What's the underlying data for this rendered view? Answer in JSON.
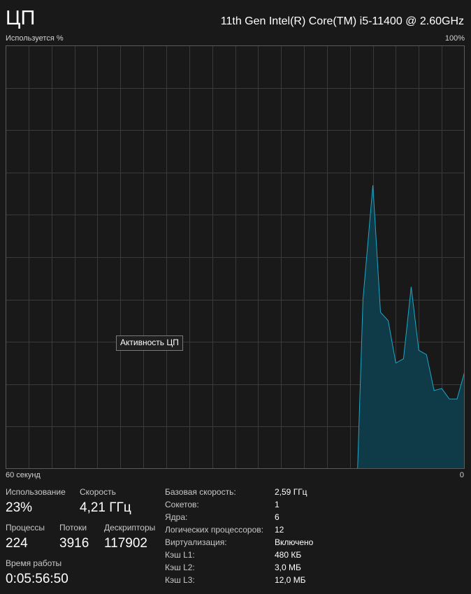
{
  "header": {
    "title": "ЦП",
    "cpu_name": "11th Gen Intel(R) Core(TM) i5-11400 @ 2.60GHz"
  },
  "graph": {
    "y_label": "Используется %",
    "y_max_label": "100%",
    "x_label": "60 секунд",
    "x_min_label": "0",
    "tooltip": "Активность ЦП",
    "line_color": "#1ea7c6",
    "fill_color": "#0f3a47",
    "grid_color": "#3a3a3a",
    "border_color": "#5a5a5a"
  },
  "chart_data": {
    "type": "area",
    "ylabel": "Используется %",
    "xlabel": "60 секунд",
    "ylim": [
      0,
      100
    ],
    "xlim": [
      60,
      0
    ],
    "grid": true,
    "series": [
      {
        "values_x": [
          60,
          14,
          13.3,
          12,
          11,
          10,
          9,
          8,
          7,
          6,
          5,
          4,
          3,
          2,
          1,
          0
        ],
        "values_y": [
          0,
          0,
          40,
          67,
          37,
          35,
          25,
          26,
          43,
          28,
          27,
          18.5,
          19,
          16.5,
          16.5,
          23
        ]
      }
    ]
  },
  "stats": {
    "utilization_label": "Использование",
    "utilization_value": "23%",
    "speed_label": "Скорость",
    "speed_value": "4,21 ГГц",
    "processes_label": "Процессы",
    "processes_value": "224",
    "threads_label": "Потоки",
    "threads_value": "3916",
    "handles_label": "Дескрипторы",
    "handles_value": "117902",
    "uptime_label": "Время работы",
    "uptime_value": "0:05:56:50"
  },
  "specs": [
    {
      "label": "Базовая скорость:",
      "value": "2,59 ГГц"
    },
    {
      "label": "Сокетов:",
      "value": "1"
    },
    {
      "label": "Ядра:",
      "value": "6"
    },
    {
      "label": "Логических процессоров:",
      "value": "12"
    },
    {
      "label": "Виртуализация:",
      "value": "Включено"
    },
    {
      "label": "Кэш L1:",
      "value": "480 КБ"
    },
    {
      "label": "Кэш L2:",
      "value": "3,0 МБ"
    },
    {
      "label": "Кэш L3:",
      "value": "12,0 МБ"
    }
  ]
}
